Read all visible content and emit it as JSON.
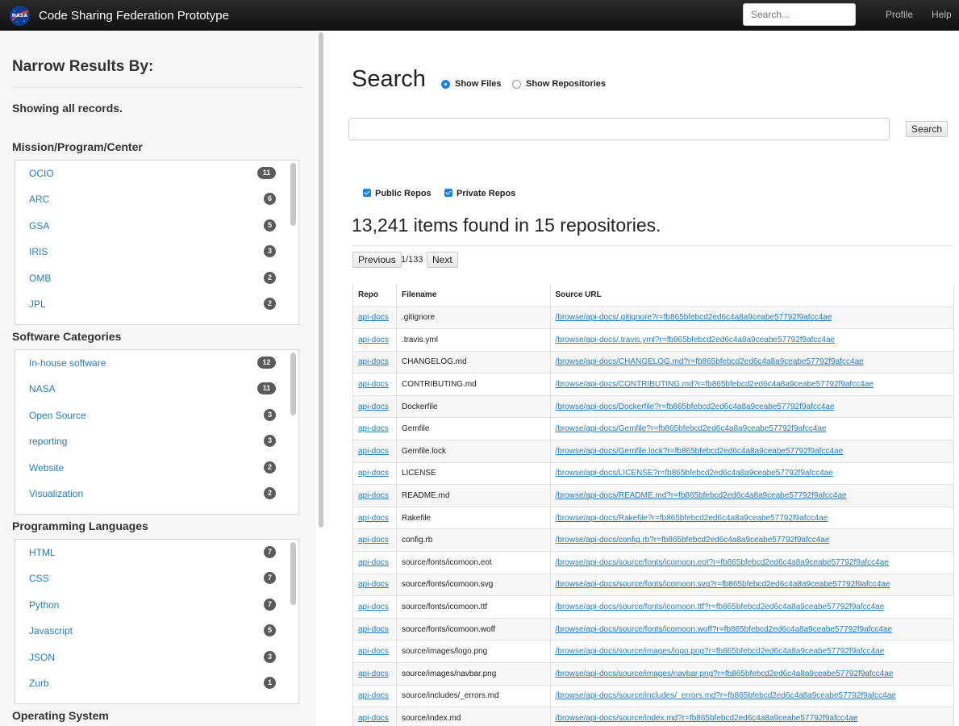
{
  "navbar": {
    "logo_text": "NASA",
    "brand": "Code Sharing Federation Prototype",
    "search_placeholder": "Search...",
    "profile": "Profile",
    "help": "Help"
  },
  "sidebar": {
    "title": "Narrow Results By:",
    "showing": "Showing all records.",
    "facets": [
      {
        "heading": "Mission/Program/Center",
        "items": [
          {
            "label": "OCIO",
            "count": "11"
          },
          {
            "label": "ARC",
            "count": "6"
          },
          {
            "label": "GSA",
            "count": "5"
          },
          {
            "label": "IRIS",
            "count": "3"
          },
          {
            "label": "OMB",
            "count": "2"
          },
          {
            "label": "JPL",
            "count": "2"
          }
        ]
      },
      {
        "heading": "Software Categories",
        "items": [
          {
            "label": "In-house software",
            "count": "12"
          },
          {
            "label": "NASA",
            "count": "11"
          },
          {
            "label": "Open Source",
            "count": "3"
          },
          {
            "label": "reporting",
            "count": "3"
          },
          {
            "label": "Website",
            "count": "2"
          },
          {
            "label": "Visualization",
            "count": "2"
          }
        ]
      },
      {
        "heading": "Programming Languages",
        "items": [
          {
            "label": "HTML",
            "count": "7"
          },
          {
            "label": "CSS",
            "count": "7"
          },
          {
            "label": "Python",
            "count": "7"
          },
          {
            "label": "Javascript",
            "count": "5"
          },
          {
            "label": "JSON",
            "count": "3"
          },
          {
            "label": "Zurb",
            "count": "1"
          }
        ]
      },
      {
        "heading": "Operating System",
        "items": []
      }
    ]
  },
  "main": {
    "title": "Search",
    "radio_files": "Show Files",
    "radio_repos": "Show Repositories",
    "search_value": "",
    "search_button": "Search",
    "check_public": "Public Repos",
    "check_private": "Private Repos",
    "found": "13,241 items found in 15 repositories.",
    "prev": "Previous",
    "page": "1/133",
    "next": "Next",
    "table": {
      "headers": [
        "Repo",
        "Filename",
        "Source URL"
      ],
      "rows": [
        [
          "api-docs",
          ".gitignore",
          "/browse/api-docs/.gitignore?r=fb865bfebcd2ed6c4a8a9ceabe57792f9afcc4ae"
        ],
        [
          "api-docs",
          ".travis.yml",
          "/browse/api-docs/.travis.yml?r=fb865bfebcd2ed6c4a8a9ceabe57792f9afcc4ae"
        ],
        [
          "api-docs",
          "CHANGELOG.md",
          "/browse/api-docs/CHANGELOG.md?r=fb865bfebcd2ed6c4a8a9ceabe57792f9afcc4ae"
        ],
        [
          "api-docs",
          "CONTRIBUTING.md",
          "/browse/api-docs/CONTRIBUTING.md?r=fb865bfebcd2ed6c4a8a9ceabe57792f9afcc4ae"
        ],
        [
          "api-docs",
          "Dockerfile",
          "/browse/api-docs/Dockerfile?r=fb865bfebcd2ed6c4a8a9ceabe57792f9afcc4ae"
        ],
        [
          "api-docs",
          "Gemfile",
          "/browse/api-docs/Gemfile?r=fb865bfebcd2ed6c4a8a9ceabe57792f9afcc4ae"
        ],
        [
          "api-docs",
          "Gemfile.lock",
          "/browse/api-docs/Gemfile.lock?r=fb865bfebcd2ed6c4a8a9ceabe57792f9afcc4ae"
        ],
        [
          "api-docs",
          "LICENSE",
          "/browse/api-docs/LICENSE?r=fb865bfebcd2ed6c4a8a9ceabe57792f9afcc4ae"
        ],
        [
          "api-docs",
          "README.md",
          "/browse/api-docs/README.md?r=fb865bfebcd2ed6c4a8a9ceabe57792f9afcc4ae"
        ],
        [
          "api-docs",
          "Rakefile",
          "/browse/api-docs/Rakefile?r=fb865bfebcd2ed6c4a8a9ceabe57792f9afcc4ae"
        ],
        [
          "api-docs",
          "config.rb",
          "/browse/api-docs/config.rb?r=fb865bfebcd2ed6c4a8a9ceabe57792f9afcc4ae"
        ],
        [
          "api-docs",
          "source/fonts/icomoon.eot",
          "/browse/api-docs/source/fonts/icomoon.eot?r=fb865bfebcd2ed6c4a8a9ceabe57792f9afcc4ae"
        ],
        [
          "api-docs",
          "source/fonts/icomoon.svg",
          "/browse/api-docs/source/fonts/icomoon.svg?r=fb865bfebcd2ed6c4a8a9ceabe57792f9afcc4ae"
        ],
        [
          "api-docs",
          "source/fonts/icomoon.ttf",
          "/browse/api-docs/source/fonts/icomoon.ttf?r=fb865bfebcd2ed6c4a8a9ceabe57792f9afcc4ae"
        ],
        [
          "api-docs",
          "source/fonts/icomoon.woff",
          "/browse/api-docs/source/fonts/icomoon.woff?r=fb865bfebcd2ed6c4a8a9ceabe57792f9afcc4ae"
        ],
        [
          "api-docs",
          "source/images/logo.png",
          "/browse/api-docs/source/images/logo.png?r=fb865bfebcd2ed6c4a8a9ceabe57792f9afcc4ae"
        ],
        [
          "api-docs",
          "source/images/navbar.png",
          "/browse/api-docs/source/images/navbar.png?r=fb865bfebcd2ed6c4a8a9ceabe57792f9afcc4ae"
        ],
        [
          "api-docs",
          "source/includes/_errors.md",
          "/browse/api-docs/source/includes/_errors.md?r=fb865bfebcd2ed6c4a8a9ceabe57792f9afcc4ae"
        ],
        [
          "api-docs",
          "source/index.md",
          "/browse/api-docs/source/index.md?r=fb865bfebcd2ed6c4a8a9ceabe57792f9afcc4ae"
        ]
      ]
    }
  }
}
